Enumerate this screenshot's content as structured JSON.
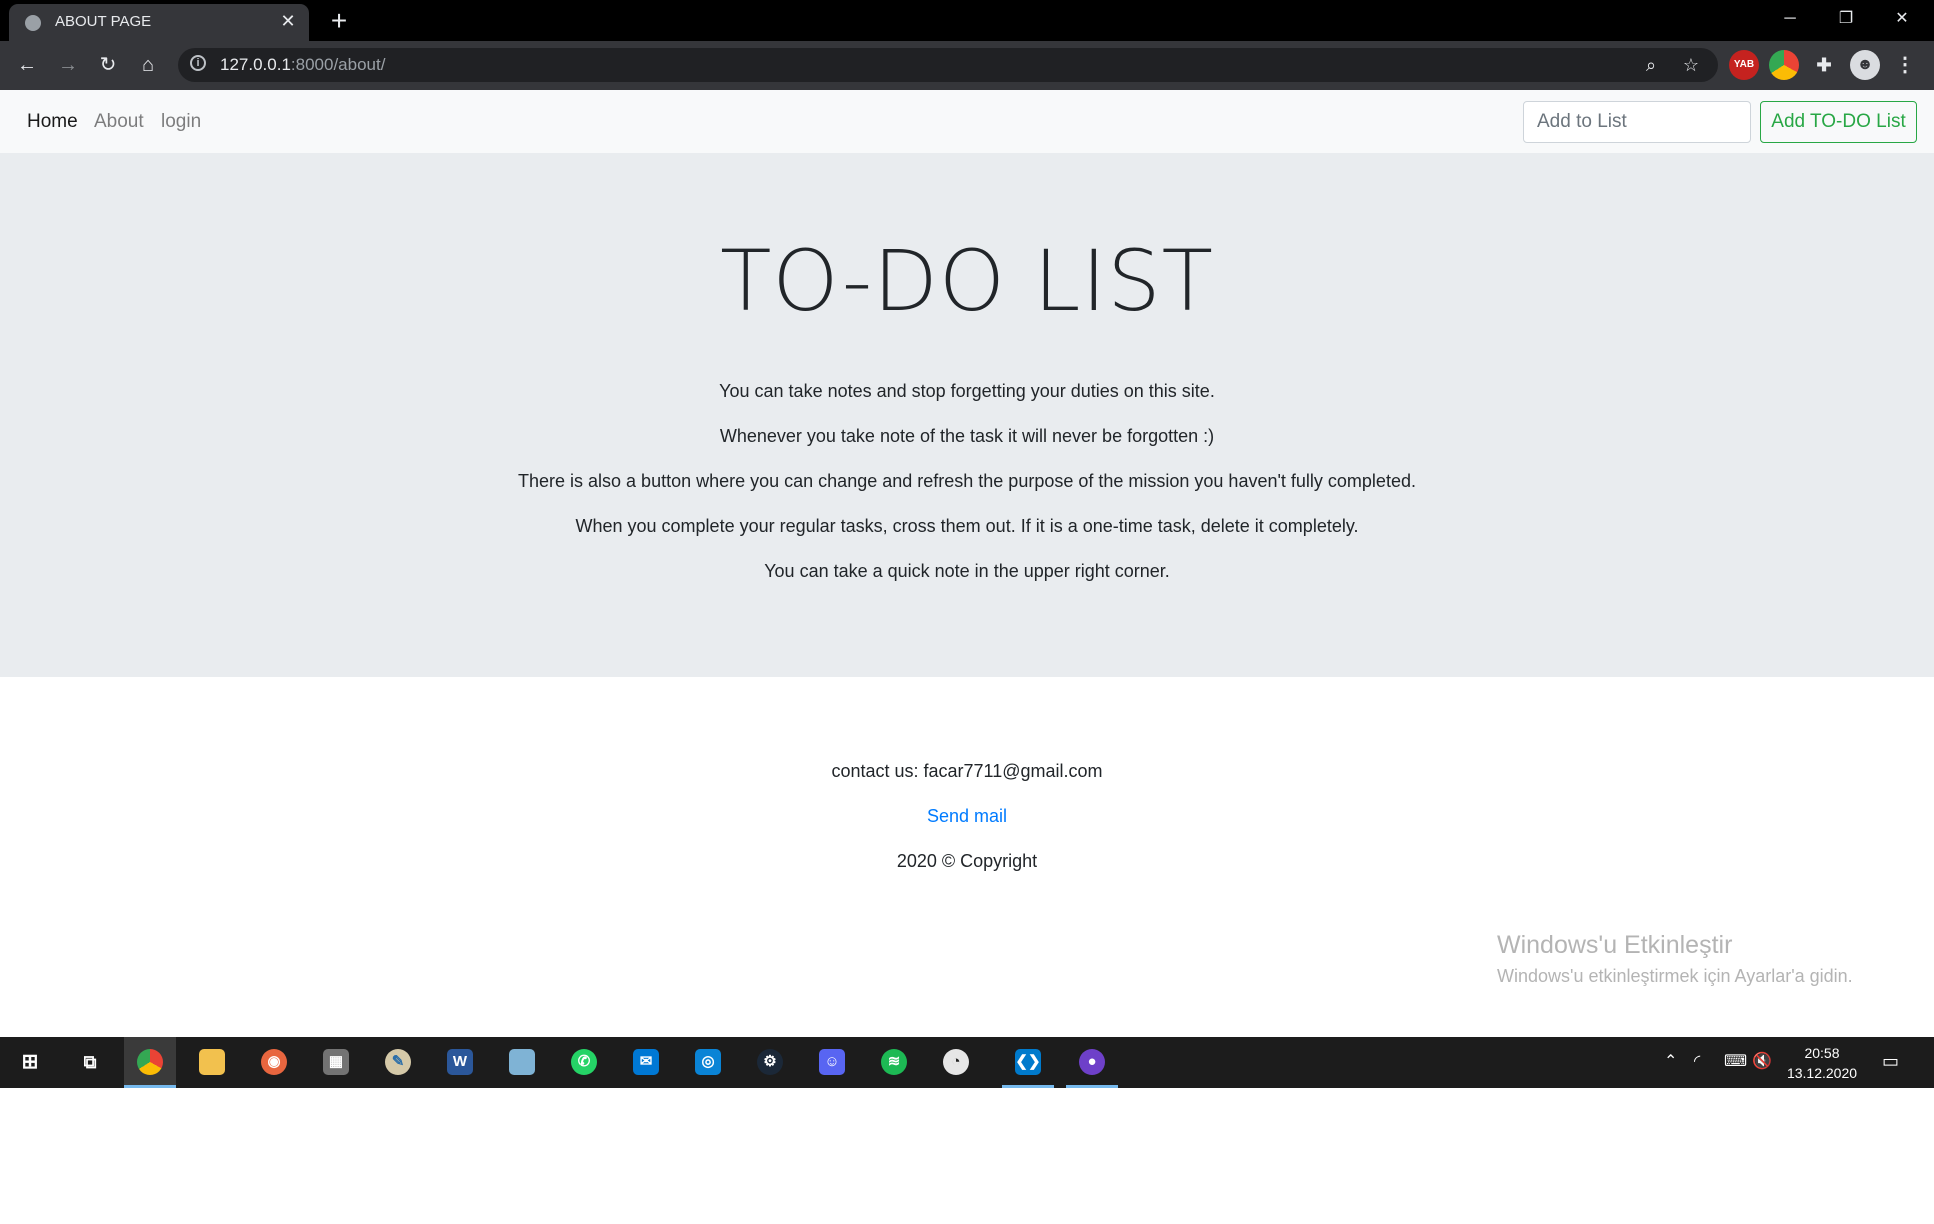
{
  "browser": {
    "tab_title": "ABOUT PAGE",
    "url_host": "127.0.0.1",
    "url_rest": ":8000/about/",
    "extension_label": "YAB"
  },
  "navbar": {
    "links": [
      "Home",
      "About",
      "login"
    ],
    "input_placeholder": "Add to List",
    "add_button": "Add TO-DO List"
  },
  "jumbotron": {
    "title": "TO-DO LIST",
    "paragraphs": [
      "You can take notes and stop forgetting your duties on this site.",
      "Whenever you take note of the task it will never be forgotten :)",
      "There is also a button where you can change and refresh the purpose of the mission you haven't fully completed.",
      "When you complete your regular tasks, cross them out. If it is a one-time task, delete it completely.",
      "You can take a quick note in the upper right corner."
    ]
  },
  "footer": {
    "contact": "contact us: facar7711@gmail.com",
    "send_mail": "Send mail",
    "copyright": "2020 © Copyright"
  },
  "watermark": {
    "title": "Windows'u Etkinleştir",
    "subtitle": "Windows'u etkinleştirmek için Ayarlar'a gidin."
  },
  "taskbar": {
    "time": "20:58",
    "date": "13.12.2020"
  },
  "colors": {
    "accent_green": "#28a745",
    "link_blue": "#007bff",
    "jumbotron_bg": "#e9ecef"
  }
}
